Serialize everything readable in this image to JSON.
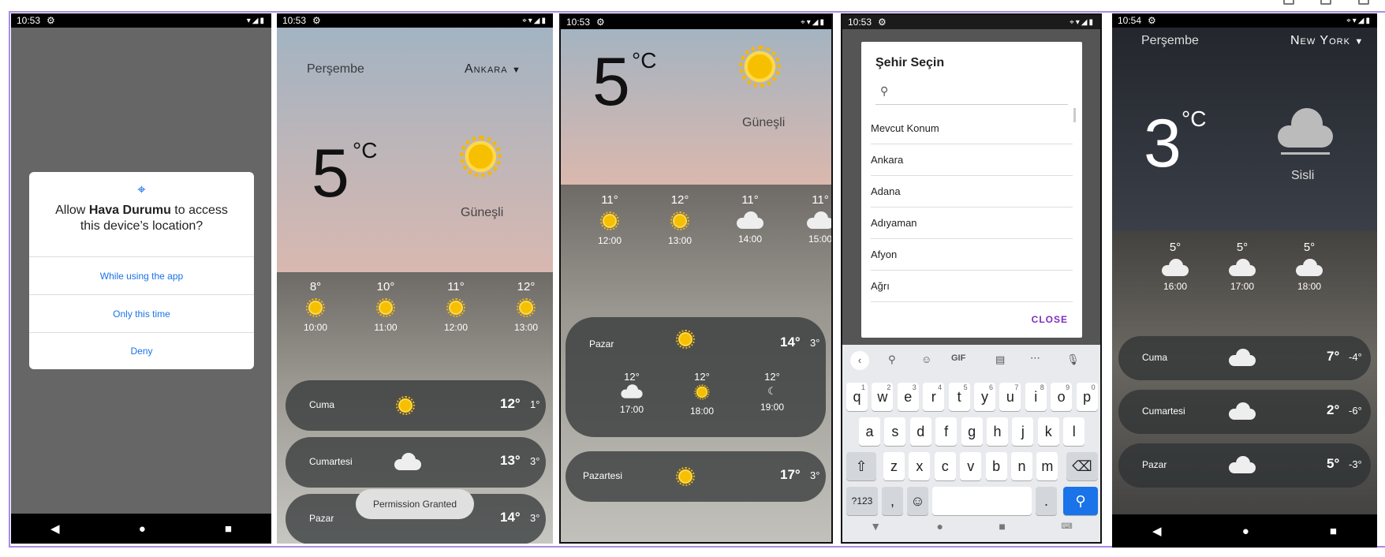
{
  "p1": {
    "time": "10:53",
    "dialog_pre": "Allow ",
    "dialog_app": "Hava Durumu",
    "dialog_post": " to access this device’s location?",
    "opt1": "While using the app",
    "opt2": "Only this time",
    "opt3": "Deny"
  },
  "p2": {
    "time": "10:53",
    "day": "Perşembe",
    "city": "Ankara",
    "temp": "5",
    "unit": "°C",
    "cond": "Güneşli",
    "hours": [
      {
        "t": "8°",
        "h": "10:00"
      },
      {
        "t": "10°",
        "h": "11:00"
      },
      {
        "t": "11°",
        "h": "12:00"
      },
      {
        "t": "12°",
        "h": "13:00"
      }
    ],
    "days": [
      {
        "n": "Cuma",
        "hi": "12°",
        "lo": "1°"
      },
      {
        "n": "Cumartesi",
        "hi": "13°",
        "lo": "3°"
      },
      {
        "n": "Pazar",
        "hi": "14°",
        "lo": "3°"
      }
    ],
    "toast": "Permission Granted"
  },
  "p3": {
    "time": "10:53",
    "temp": "5",
    "unit": "°C",
    "cond": "Güneşli",
    "hours": [
      {
        "t": "11°",
        "h": "12:00"
      },
      {
        "t": "12°",
        "h": "13:00"
      },
      {
        "t": "11°",
        "h": "14:00"
      },
      {
        "t": "11°",
        "h": "15:00"
      }
    ],
    "expanded": {
      "n": "Pazar",
      "hi": "14°",
      "lo": "3°",
      "sub": [
        {
          "t": "12°",
          "h": "17:00"
        },
        {
          "t": "12°",
          "h": "18:00"
        },
        {
          "t": "12°",
          "h": "19:00"
        }
      ]
    },
    "next": {
      "n": "Pazartesi",
      "hi": "17°",
      "lo": "3°"
    }
  },
  "p4": {
    "time": "10:53",
    "title": "Şehir Seçin",
    "items": [
      "Mevcut Konum",
      "Ankara",
      "Adana",
      "Adıyaman",
      "Afyon",
      "Ağrı"
    ],
    "close": "CLOSE",
    "row1": [
      "q",
      "w",
      "e",
      "r",
      "t",
      "y",
      "u",
      "i",
      "o",
      "p"
    ],
    "nums": [
      "1",
      "2",
      "3",
      "4",
      "5",
      "6",
      "7",
      "8",
      "9",
      "0"
    ],
    "row2": [
      "a",
      "s",
      "d",
      "f",
      "g",
      "h",
      "j",
      "k",
      "l"
    ],
    "row3": [
      "z",
      "x",
      "c",
      "v",
      "b",
      "n",
      "m"
    ],
    "sym": "?123",
    "comma": ",",
    "dot": ".",
    "gif": "GIF"
  },
  "p5": {
    "time": "10:54",
    "day": "Perşembe",
    "city": "New York",
    "temp": "3",
    "unit": "°C",
    "cond": "Sisli",
    "hours": [
      {
        "t": "5°",
        "h": "16:00"
      },
      {
        "t": "5°",
        "h": "17:00"
      },
      {
        "t": "5°",
        "h": "18:00"
      }
    ],
    "days": [
      {
        "n": "Cuma",
        "hi": "7°",
        "lo": "-4°"
      },
      {
        "n": "Cumartesi",
        "hi": "2°",
        "lo": "-6°"
      },
      {
        "n": "Pazar",
        "hi": "5°",
        "lo": "-3°"
      }
    ]
  }
}
